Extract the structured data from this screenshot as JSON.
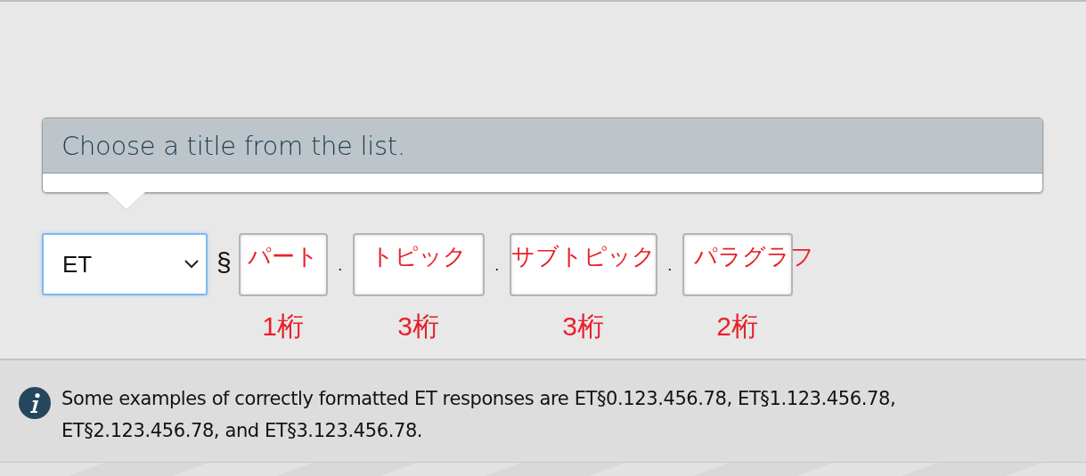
{
  "callout": {
    "text": "Choose a title from the list."
  },
  "citation": {
    "select": {
      "value": "ET",
      "focused": true
    },
    "section_sign": "§",
    "fields": [
      {
        "annotation": "パート",
        "digits": "1桁",
        "separator": "."
      },
      {
        "annotation": "トピック",
        "digits": "3桁",
        "separator": "."
      },
      {
        "annotation": "サブトピック",
        "digits": "3桁",
        "separator": "."
      },
      {
        "annotation": "パラグラフ",
        "digits": "2桁"
      }
    ]
  },
  "info": {
    "text": "Some examples of correctly formatted ET responses are ET§0.123.456.78, ET§1.123.456.78, ET§2.123.456.78, and ET§3.123.456.78."
  }
}
